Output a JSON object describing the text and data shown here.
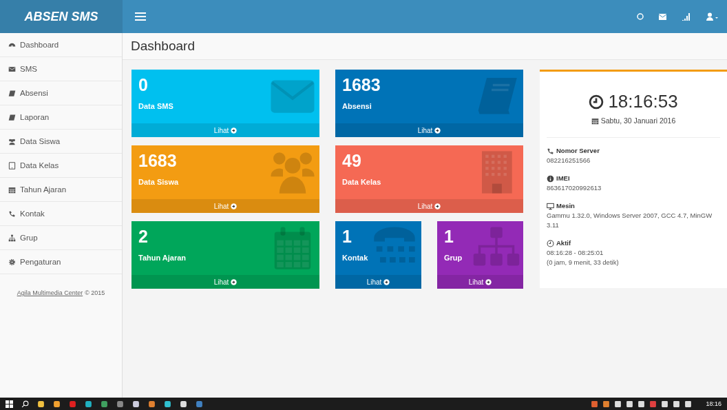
{
  "brand": "ABSEN SMS",
  "sidebar": {
    "items": [
      {
        "label": "Dashboard",
        "kind": "dashboard"
      },
      {
        "label": "SMS",
        "kind": "envelope"
      },
      {
        "label": "Absensi",
        "kind": "book"
      },
      {
        "label": "Laporan",
        "kind": "book"
      },
      {
        "label": "Data Siswa",
        "kind": "users"
      },
      {
        "label": "Data Kelas",
        "kind": "tablet"
      },
      {
        "label": "Tahun Ajaran",
        "kind": "calendar"
      },
      {
        "label": "Kontak",
        "kind": "phone"
      },
      {
        "label": "Grup",
        "kind": "sitemap"
      },
      {
        "label": "Pengaturan",
        "kind": "gear"
      }
    ],
    "footer": {
      "link": "Agila Multimedia Center",
      "suffix": "© 2015"
    }
  },
  "page_title": "Dashboard",
  "card_rows": [
    {
      "cards": [
        {
          "value": "0",
          "label": "Data SMS",
          "footer": "Lihat",
          "color": "#00c0ef",
          "kind": "envelope"
        },
        {
          "value": "1683",
          "label": "Absensi",
          "footer": "Lihat",
          "color": "#0073b7",
          "kind": "book"
        }
      ]
    },
    {
      "cards": [
        {
          "value": "1683",
          "label": "Data Siswa",
          "footer": "Lihat",
          "color": "#f39c12",
          "kind": "users"
        },
        {
          "value": "49",
          "label": "Data Kelas",
          "footer": "Lihat",
          "color": "#f56954",
          "kind": "building"
        }
      ]
    },
    {
      "cards": [
        {
          "value": "2",
          "label": "Tahun Ajaran",
          "footer": "Lihat",
          "color": "#00a65a",
          "kind": "calendar"
        },
        {
          "value": "1",
          "label": "Kontak",
          "footer": "Lihat",
          "color": "#0073b7",
          "kind": "phone"
        },
        {
          "value": "1",
          "label": "Grup",
          "footer": "Lihat",
          "color": "#932ab6",
          "kind": "sitemap"
        }
      ]
    }
  ],
  "info": {
    "time": "18:16:53",
    "date": "Sabtu, 30 Januari 2016",
    "sections": [
      {
        "label": "Nomor Server",
        "kind": "phone",
        "lines": [
          "082216251566"
        ]
      },
      {
        "label": "IMEI",
        "kind": "info",
        "lines": [
          "863617020992613"
        ]
      },
      {
        "label": "Mesin",
        "kind": "monitor",
        "lines": [
          "Gammu 1.32.0, Windows Server 2007, GCC 4.7, MinGW 3.11"
        ]
      },
      {
        "label": "Aktif",
        "kind": "clock",
        "lines": [
          "08:16:28 - 08:25:01",
          "(0 jam, 9 menit, 33 detik)"
        ]
      }
    ]
  },
  "taskbar": {
    "clock": "18:16"
  }
}
